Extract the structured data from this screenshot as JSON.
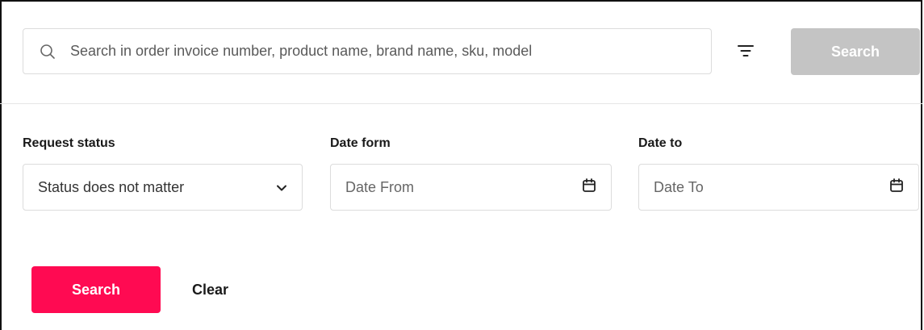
{
  "top": {
    "search_placeholder": "Search in order invoice number, product name, brand name, sku, model",
    "search_button": "Search"
  },
  "filters": {
    "request_status": {
      "label": "Request status",
      "value": "Status does not matter"
    },
    "date_from": {
      "label": "Date form",
      "placeholder": "Date From"
    },
    "date_to": {
      "label": "Date to",
      "placeholder": "Date To"
    }
  },
  "actions": {
    "search": "Search",
    "clear": "Clear"
  },
  "colors": {
    "primary": "#ff0a52",
    "disabled": "#c4c4c4",
    "border": "#dcdcdc"
  },
  "icons": {
    "search": "search-icon",
    "filter": "filter-icon",
    "chevron": "chevron-down-icon",
    "calendar": "calendar-icon"
  }
}
